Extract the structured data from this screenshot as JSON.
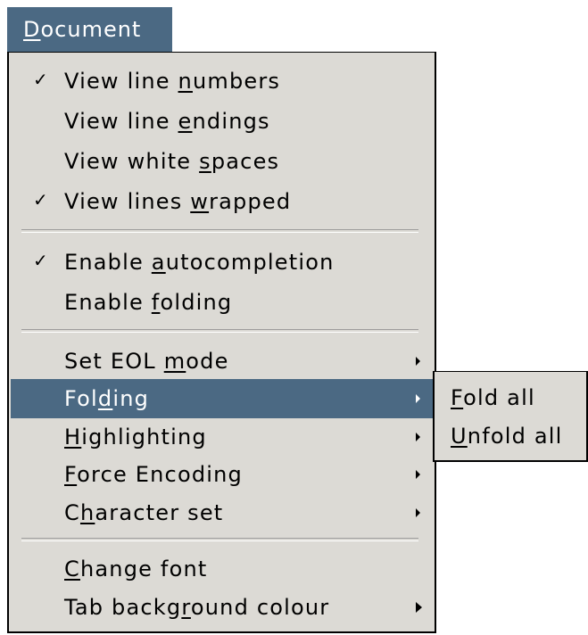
{
  "menubar": {
    "document_label": "Document",
    "document_mnemonic": "D"
  },
  "menu": {
    "items": [
      {
        "pre": "View line ",
        "u": "n",
        "post": "umbers",
        "checked": "✓"
      },
      {
        "pre": "View line ",
        "u": "e",
        "post": "ndings",
        "checked": ""
      },
      {
        "pre": "View white ",
        "u": "s",
        "post": "paces",
        "checked": ""
      },
      {
        "pre": "View lines ",
        "u": "w",
        "post": "rapped",
        "checked": "✓"
      },
      {
        "pre": "Enable ",
        "u": "a",
        "post": "utocompletion",
        "checked": "✓"
      },
      {
        "pre": "Enable ",
        "u": "f",
        "post": "olding",
        "checked": ""
      },
      {
        "pre": "Set EOL ",
        "u": "m",
        "post": "ode"
      },
      {
        "pre": "Fol",
        "u": "d",
        "post": "ing"
      },
      {
        "pre": "",
        "u": "H",
        "post": "ighlighting"
      },
      {
        "pre": "",
        "u": "F",
        "post": "orce Encoding"
      },
      {
        "pre": "C",
        "u": "h",
        "post": "aracter set"
      },
      {
        "pre": "",
        "u": "C",
        "post": "hange font"
      },
      {
        "pre": "Tab backg",
        "u": "r",
        "post": "ound colour"
      }
    ]
  },
  "submenu": {
    "items": [
      {
        "pre": "",
        "u": "F",
        "post": "old all"
      },
      {
        "pre": "",
        "u": "U",
        "post": "nfold all"
      }
    ]
  }
}
